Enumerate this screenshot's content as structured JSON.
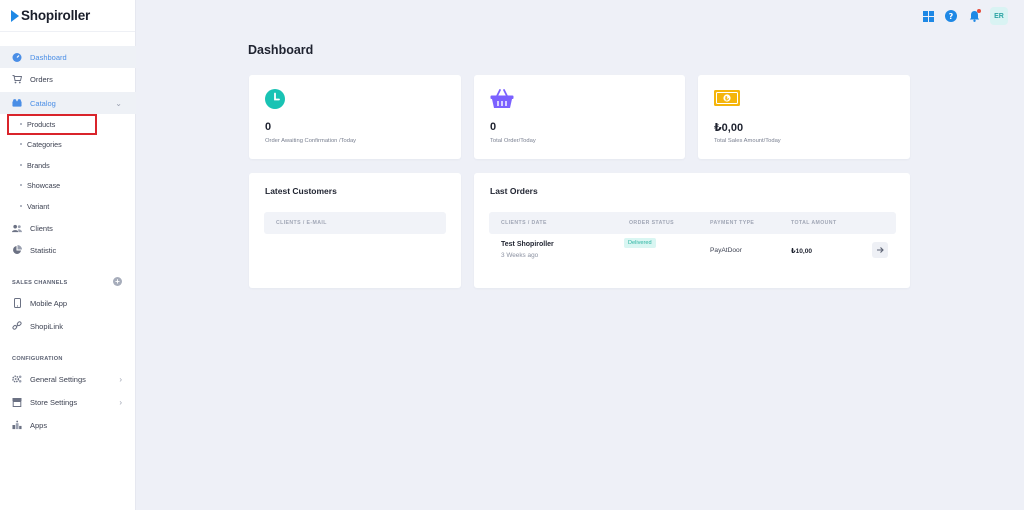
{
  "app": {
    "brand": "Shopiroller"
  },
  "sidebar": {
    "items": [
      {
        "label": "Dashboard",
        "icon": "dashboard-icon"
      },
      {
        "label": "Orders",
        "icon": "cart-icon"
      },
      {
        "label": "Catalog",
        "icon": "catalog-icon"
      },
      {
        "label": "Clients",
        "icon": "users-icon"
      },
      {
        "label": "Statistic",
        "icon": "pie-chart-icon"
      }
    ],
    "catalog_sub": [
      {
        "label": "Products"
      },
      {
        "label": "Categories"
      },
      {
        "label": "Brands"
      },
      {
        "label": "Showcase"
      },
      {
        "label": "Variant"
      }
    ],
    "sales_channels_title": "SALES CHANNELS",
    "sales_channels": [
      {
        "label": "Mobile App",
        "icon": "mobile-icon"
      },
      {
        "label": "ShopiLink",
        "icon": "link-icon"
      }
    ],
    "configuration_title": "CONFIGURATION",
    "configuration": [
      {
        "label": "General Settings",
        "icon": "settings-icon"
      },
      {
        "label": "Store Settings",
        "icon": "store-icon"
      },
      {
        "label": "Apps",
        "icon": "apps-icon"
      }
    ]
  },
  "topbar": {
    "avatar_initials": "ER"
  },
  "page": {
    "title": "Dashboard"
  },
  "stats": [
    {
      "value": "0",
      "label": "Order Awaiting Confirmation /Today",
      "icon": "clock-icon",
      "color": "#19c3b4"
    },
    {
      "value": "0",
      "label": "Total Order/Today",
      "icon": "basket-icon",
      "color": "#7b61ff"
    },
    {
      "value": "₺0,00",
      "label": "Total Sales Amount/Today",
      "icon": "money-icon",
      "color": "#f5b50a"
    }
  ],
  "latest_customers": {
    "title": "Latest Customers",
    "columns": [
      "CLIENTS / E-MAIL"
    ]
  },
  "last_orders": {
    "title": "Last Orders",
    "columns": [
      "CLIENTS / DATE",
      "ORDER STATUS",
      "PAYMENT TYPE",
      "TOTAL AMOUNT"
    ],
    "rows": [
      {
        "client": "Test Shopiroller",
        "date": "3 Weeks ago",
        "status": "Delivered",
        "payment": "PayAtDoor",
        "amount": "₺10,00"
      }
    ]
  }
}
